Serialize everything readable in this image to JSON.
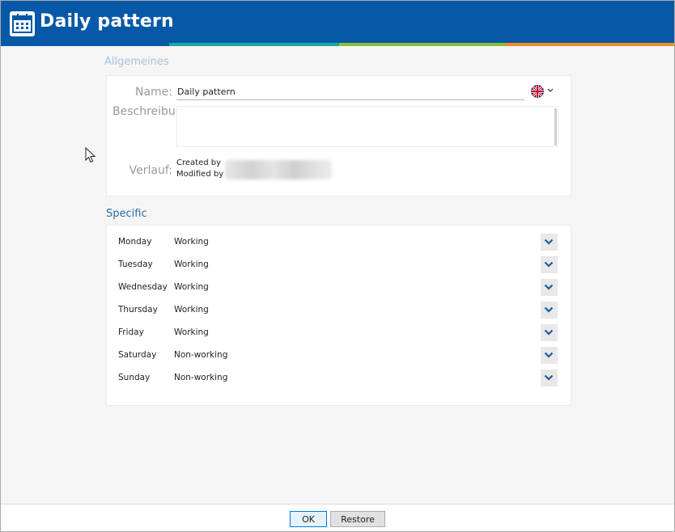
{
  "window": {
    "title": "Daily pattern"
  },
  "general": {
    "header": "Allgemeines",
    "name_label": "Name:",
    "name_value": "Daily pattern",
    "description_label": "Beschreibung:",
    "description_value": "",
    "history_label": "Verlauf:",
    "created_by": "Created by",
    "modified_by": "Modified by"
  },
  "specific": {
    "header": "Specific",
    "days": [
      {
        "day": "Monday",
        "status": "Working"
      },
      {
        "day": "Tuesday",
        "status": "Working"
      },
      {
        "day": "Wednesday",
        "status": "Working"
      },
      {
        "day": "Thursday",
        "status": "Working"
      },
      {
        "day": "Friday",
        "status": "Working"
      },
      {
        "day": "Saturday",
        "status": "Non-working"
      },
      {
        "day": "Sunday",
        "status": "Non-working"
      }
    ]
  },
  "footer": {
    "ok_label": "OK",
    "restore_label": "Restore"
  },
  "colors": {
    "titlebar": "#0758a7",
    "stripe_teal": "#1ba6a3",
    "stripe_green": "#8cbf3a",
    "stripe_orange": "#f08a24",
    "section_header": "#2b6ea5",
    "dropdown_chevron": "#1b5e9e"
  },
  "icons": {
    "title": "calendar-icon",
    "language": "uk-flag-icon",
    "dropdown": "chevron-down-icon"
  }
}
